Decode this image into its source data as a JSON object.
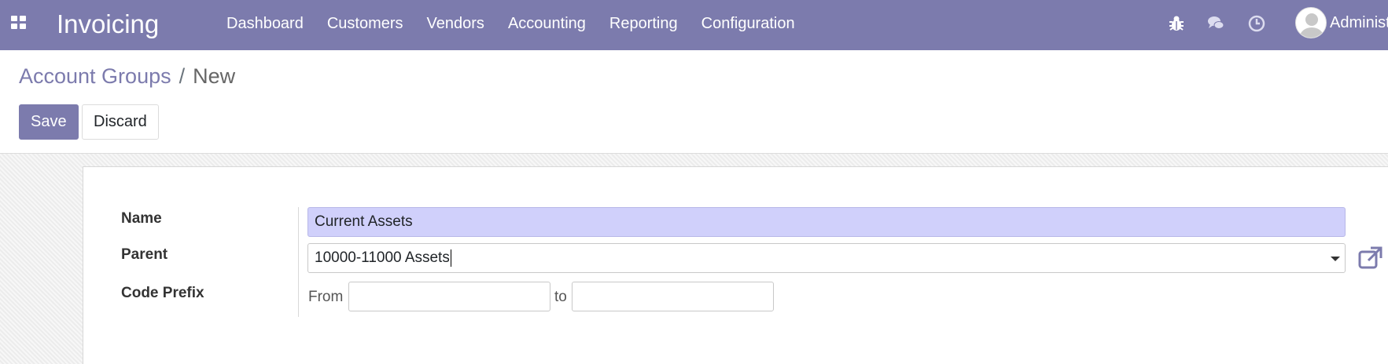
{
  "navbar": {
    "brand": "Invoicing",
    "menu": [
      {
        "label": "Dashboard"
      },
      {
        "label": "Customers"
      },
      {
        "label": "Vendors"
      },
      {
        "label": "Accounting"
      },
      {
        "label": "Reporting"
      },
      {
        "label": "Configuration"
      }
    ],
    "icons": [
      "apps-icon",
      "bug-icon",
      "chat-icon",
      "clock-icon"
    ],
    "user_name": "Administ"
  },
  "breadcrumb": {
    "parent": "Account Groups",
    "separator": "/",
    "current": "New"
  },
  "buttons": {
    "save": "Save",
    "discard": "Discard"
  },
  "form": {
    "name_label": "Name",
    "name_value": "Current Assets",
    "parent_label": "Parent",
    "parent_value": "10000-11000 Assets",
    "code_prefix_label": "Code Prefix",
    "from_label": "From",
    "from_value": "",
    "to_label": "to",
    "to_value": ""
  },
  "colors": {
    "brand": "#7c7bad",
    "name_field_bg": "#d0d0fb"
  }
}
